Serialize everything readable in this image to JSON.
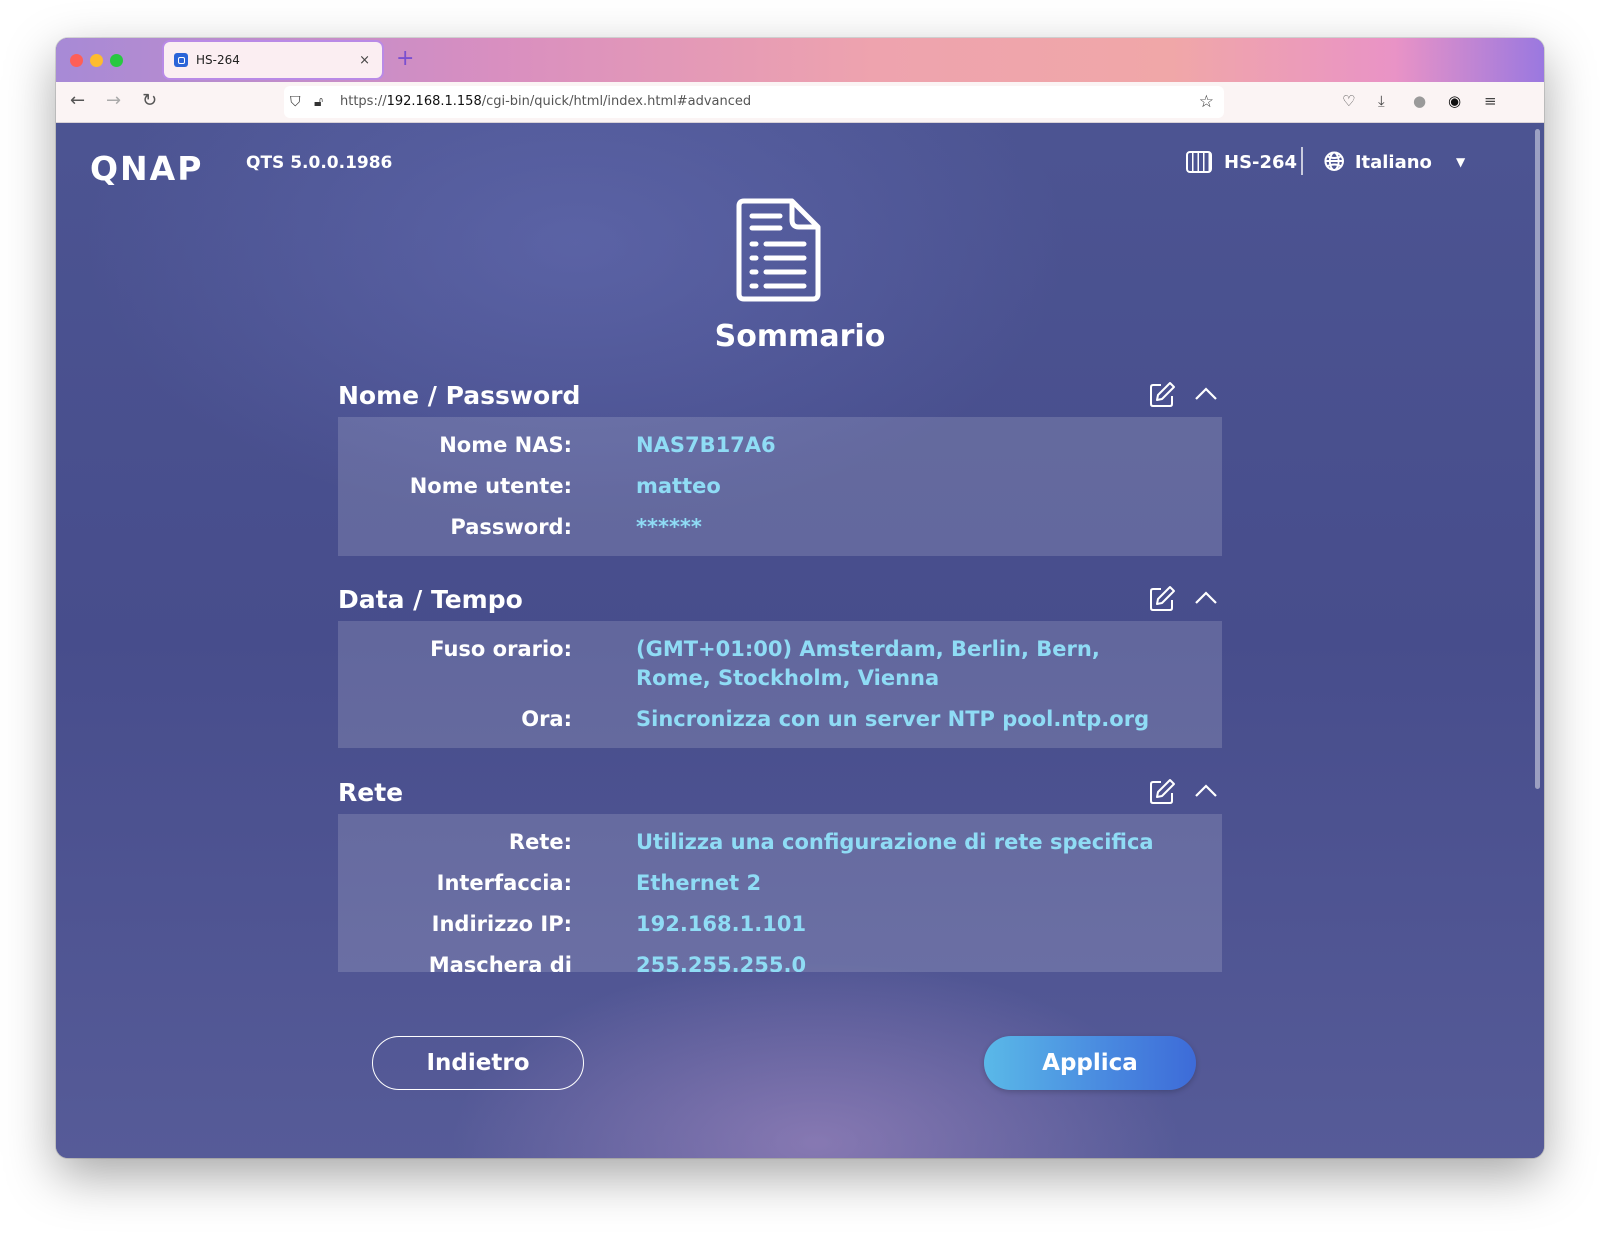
{
  "browser": {
    "tab_title": "HS-264",
    "tab_close": "×",
    "new_tab": "+",
    "url_prefix": "https://",
    "url_host": "192.168.1.158",
    "url_path": "/cgi-bin/quick/html/index.html#advanced"
  },
  "header": {
    "logo": "QNAP",
    "version": "QTS 5.0.0.1986",
    "device_name": "HS-264",
    "language": "Italiano"
  },
  "page_title": "Sommario",
  "sections": [
    {
      "title": "Nome / Password",
      "rows": [
        {
          "label": "Nome NAS:",
          "value": "NAS7B17A6"
        },
        {
          "label": "Nome utente:",
          "value": "matteo"
        },
        {
          "label": "Password:",
          "value": "******"
        }
      ]
    },
    {
      "title": "Data / Tempo",
      "rows": [
        {
          "label": "Fuso orario:",
          "value": "(GMT+01:00) Amsterdam, Berlin, Bern, Rome, Stockholm, Vienna"
        },
        {
          "label": "Ora:",
          "value": "Sincronizza con un server NTP pool.ntp.org"
        }
      ]
    },
    {
      "title": "Rete",
      "rows": [
        {
          "label": "Rete:",
          "value": "Utilizza una configurazione di rete specifica"
        },
        {
          "label": "Interfaccia:",
          "value": "Ethernet 2"
        },
        {
          "label": "Indirizzo IP:",
          "value": "192.168.1.101"
        },
        {
          "label": "Maschera di",
          "value": "255.255.255.0"
        }
      ]
    }
  ],
  "buttons": {
    "back": "Indietro",
    "apply": "Applica"
  },
  "colors": {
    "background": "#4a4f8c",
    "value_text": "#8fdcf5",
    "apply_button": "#4a8be0"
  }
}
